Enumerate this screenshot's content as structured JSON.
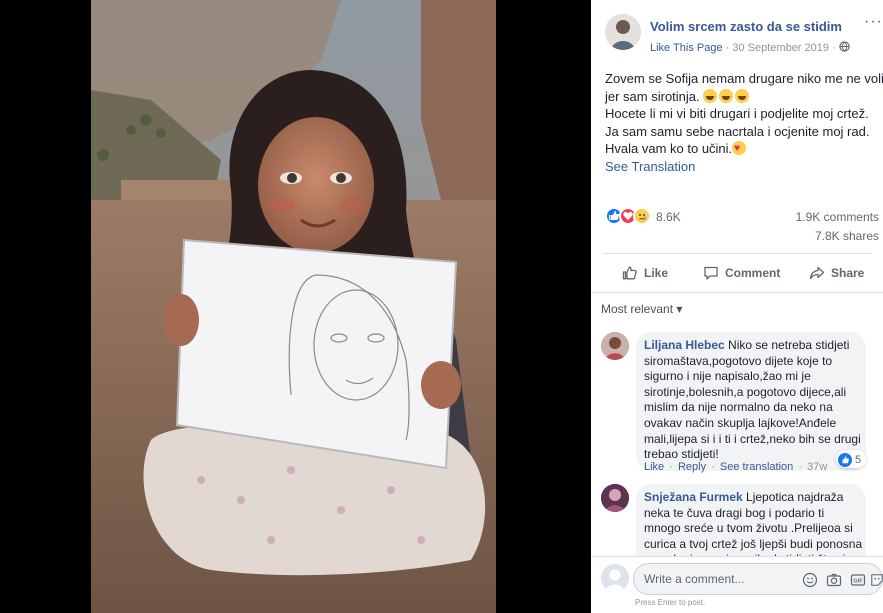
{
  "post": {
    "page_name": "Volim srcem zasto da se stidim",
    "like_page": "Like This Page",
    "dot": "·",
    "date": "30 September 2019",
    "dot2": "·",
    "more": "···",
    "text_lines": [
      "Zovem se Sofija nemam drugare niko me ne voli",
      "jer sam sirotinja.",
      "Hocete li mi vi biti drugari i podjelite moj crtež.",
      "Ja sam samu sebe nacrtala i ocjenite moj rad.",
      "Hvala vam ko to učini."
    ],
    "see_translation": "See Translation"
  },
  "stats": {
    "reaction_count": "8.6K",
    "comments": "1.9K comments",
    "shares": "7.8K shares"
  },
  "actions": {
    "like": "Like",
    "comment": "Comment",
    "share": "Share"
  },
  "sort": "Most relevant ▾",
  "comments": [
    {
      "author": "Liljana Hlebec",
      "first_line": " Niko se netreba stidjeti",
      "lines": [
        "siromaštava,pogotovo dijete koje to",
        "sigurno i nije napisalo,žao mi je",
        "sirotinje,bolesnih,a pogotovo dijece,ali",
        "mislim da nije normalno da neko na",
        "ovakav način skuplja lajkove!Anđele",
        "mali,lijepa si i i ti i crtež,neko bih se drugi",
        "trebao stidjeti!"
      ],
      "likes": "5",
      "like_label": "Like",
      "reply_label": "Reply",
      "translation_label": "See translation",
      "time": "37w",
      "sep": "·"
    },
    {
      "author": "Snježana Furmek",
      "first_line": " Ljepotica najdraža",
      "lines": [
        "neka te čuva dragi bog i podario ti",
        "mnogo sreće u tvom životu .Prelijeoa si",
        "curica a tvoj crtež još ljepši budi ponosna",
        "na sebe i nemoj se nikad stidjeti što si"
      ]
    }
  ],
  "composer": {
    "placeholder": "Write a comment...",
    "hint": "Press Enter to post."
  },
  "colors": {
    "link": "#365899",
    "like_blue": "#1877f2",
    "love_red": "#f33e58",
    "bubble": "#f2f3f5"
  }
}
